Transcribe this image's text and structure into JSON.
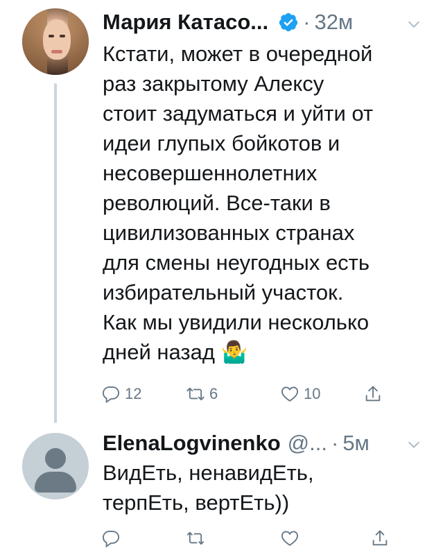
{
  "tweet1": {
    "author_name": "Мария Катасо...",
    "time": "32м",
    "text_lines": [
      "Кстати, может в очередной",
      "раз закрытому Алексу",
      "стоит задуматься и уйти от",
      "идеи глупых бойкотов и",
      "несовершеннолетних",
      "революций. Все-таки в",
      "цивилизованных странах",
      "для смены неугодных есть",
      "избирательный участок.",
      "Как мы увидили несколько",
      "дней назад 🤷‍♂️"
    ],
    "reply_count": "12",
    "retweet_count": "6",
    "like_count": "10"
  },
  "tweet2": {
    "author_name": "ElenaLogvinenko",
    "handle": "@...",
    "time": "5м",
    "text_lines": [
      "ВидЕть, ненавидЕть,",
      "терпЕть, вертЕть))"
    ]
  },
  "colors": {
    "text": "#14171a",
    "secondary": "#657786",
    "verified": "#1da1f2",
    "thread_line": "#ccd6dd"
  },
  "icons": [
    "verified-badge-icon",
    "chevron-down-icon",
    "reply-icon",
    "retweet-icon",
    "like-icon",
    "share-icon"
  ]
}
